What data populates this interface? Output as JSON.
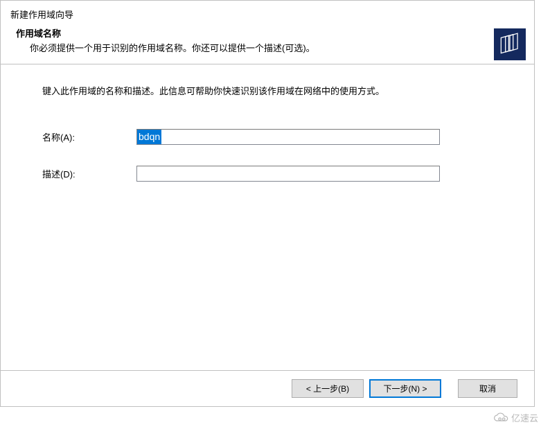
{
  "header": {
    "window_title": "新建作用域向导",
    "section_title": "作用域名称",
    "section_desc": "你必须提供一个用于识别的作用域名称。你还可以提供一个描述(可选)。"
  },
  "content": {
    "intro": "键入此作用域的名称和描述。此信息可帮助你快速识别该作用域在网络中的使用方式。",
    "name_label": "名称(A):",
    "name_value": "bdqn",
    "desc_label": "描述(D):",
    "desc_value": ""
  },
  "footer": {
    "back": "< 上一步(B)",
    "next": "下一步(N) >",
    "cancel": "取消"
  },
  "watermark": {
    "text": "亿速云"
  }
}
